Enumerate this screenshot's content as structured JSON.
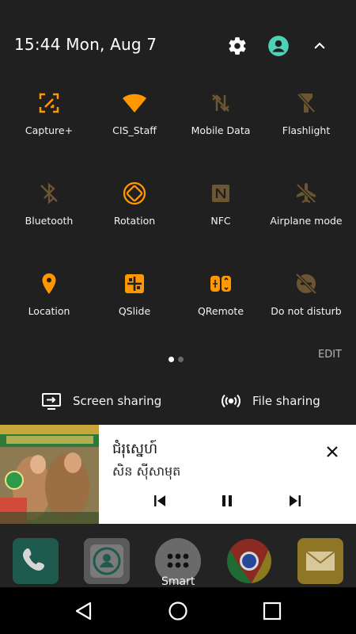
{
  "header": {
    "time": "15:44",
    "date": "Mon, Aug 7"
  },
  "tiles": [
    {
      "label": "Capture+",
      "icon": "capture-plus-icon",
      "active": true
    },
    {
      "label": "CIS_Staff",
      "icon": "wifi-icon",
      "active": true
    },
    {
      "label": "Mobile Data",
      "icon": "mobile-data-icon",
      "active": false
    },
    {
      "label": "Flashlight",
      "icon": "flashlight-icon",
      "active": false
    },
    {
      "label": "Bluetooth",
      "icon": "bluetooth-icon",
      "active": false
    },
    {
      "label": "Rotation",
      "icon": "rotation-icon",
      "active": true
    },
    {
      "label": "NFC",
      "icon": "nfc-icon",
      "active": false
    },
    {
      "label": "Airplane mode",
      "icon": "airplane-icon",
      "active": false
    },
    {
      "label": "Location",
      "icon": "location-icon",
      "active": true
    },
    {
      "label": "QSlide",
      "icon": "qslide-icon",
      "active": true
    },
    {
      "label": "QRemote",
      "icon": "qremote-icon",
      "active": true
    },
    {
      "label": "Do not disturb",
      "icon": "do-not-disturb-icon",
      "active": false
    }
  ],
  "pager": {
    "edit_label": "EDIT",
    "pages": 2,
    "current": 1
  },
  "sharing": {
    "screen_label": "Screen sharing",
    "file_label": "File sharing"
  },
  "media": {
    "title": "ជំរុស្នេហ៍",
    "artist": "សិន ស៊ីសាមុត"
  },
  "dock": {
    "apps": [
      "phone-app",
      "contacts-app",
      "apps-drawer",
      "chrome-app",
      "email-app"
    ],
    "folder_label": "Smart"
  },
  "colors": {
    "accent": "#ff9800",
    "inactive": "#6b5532",
    "panel": "#202020"
  }
}
